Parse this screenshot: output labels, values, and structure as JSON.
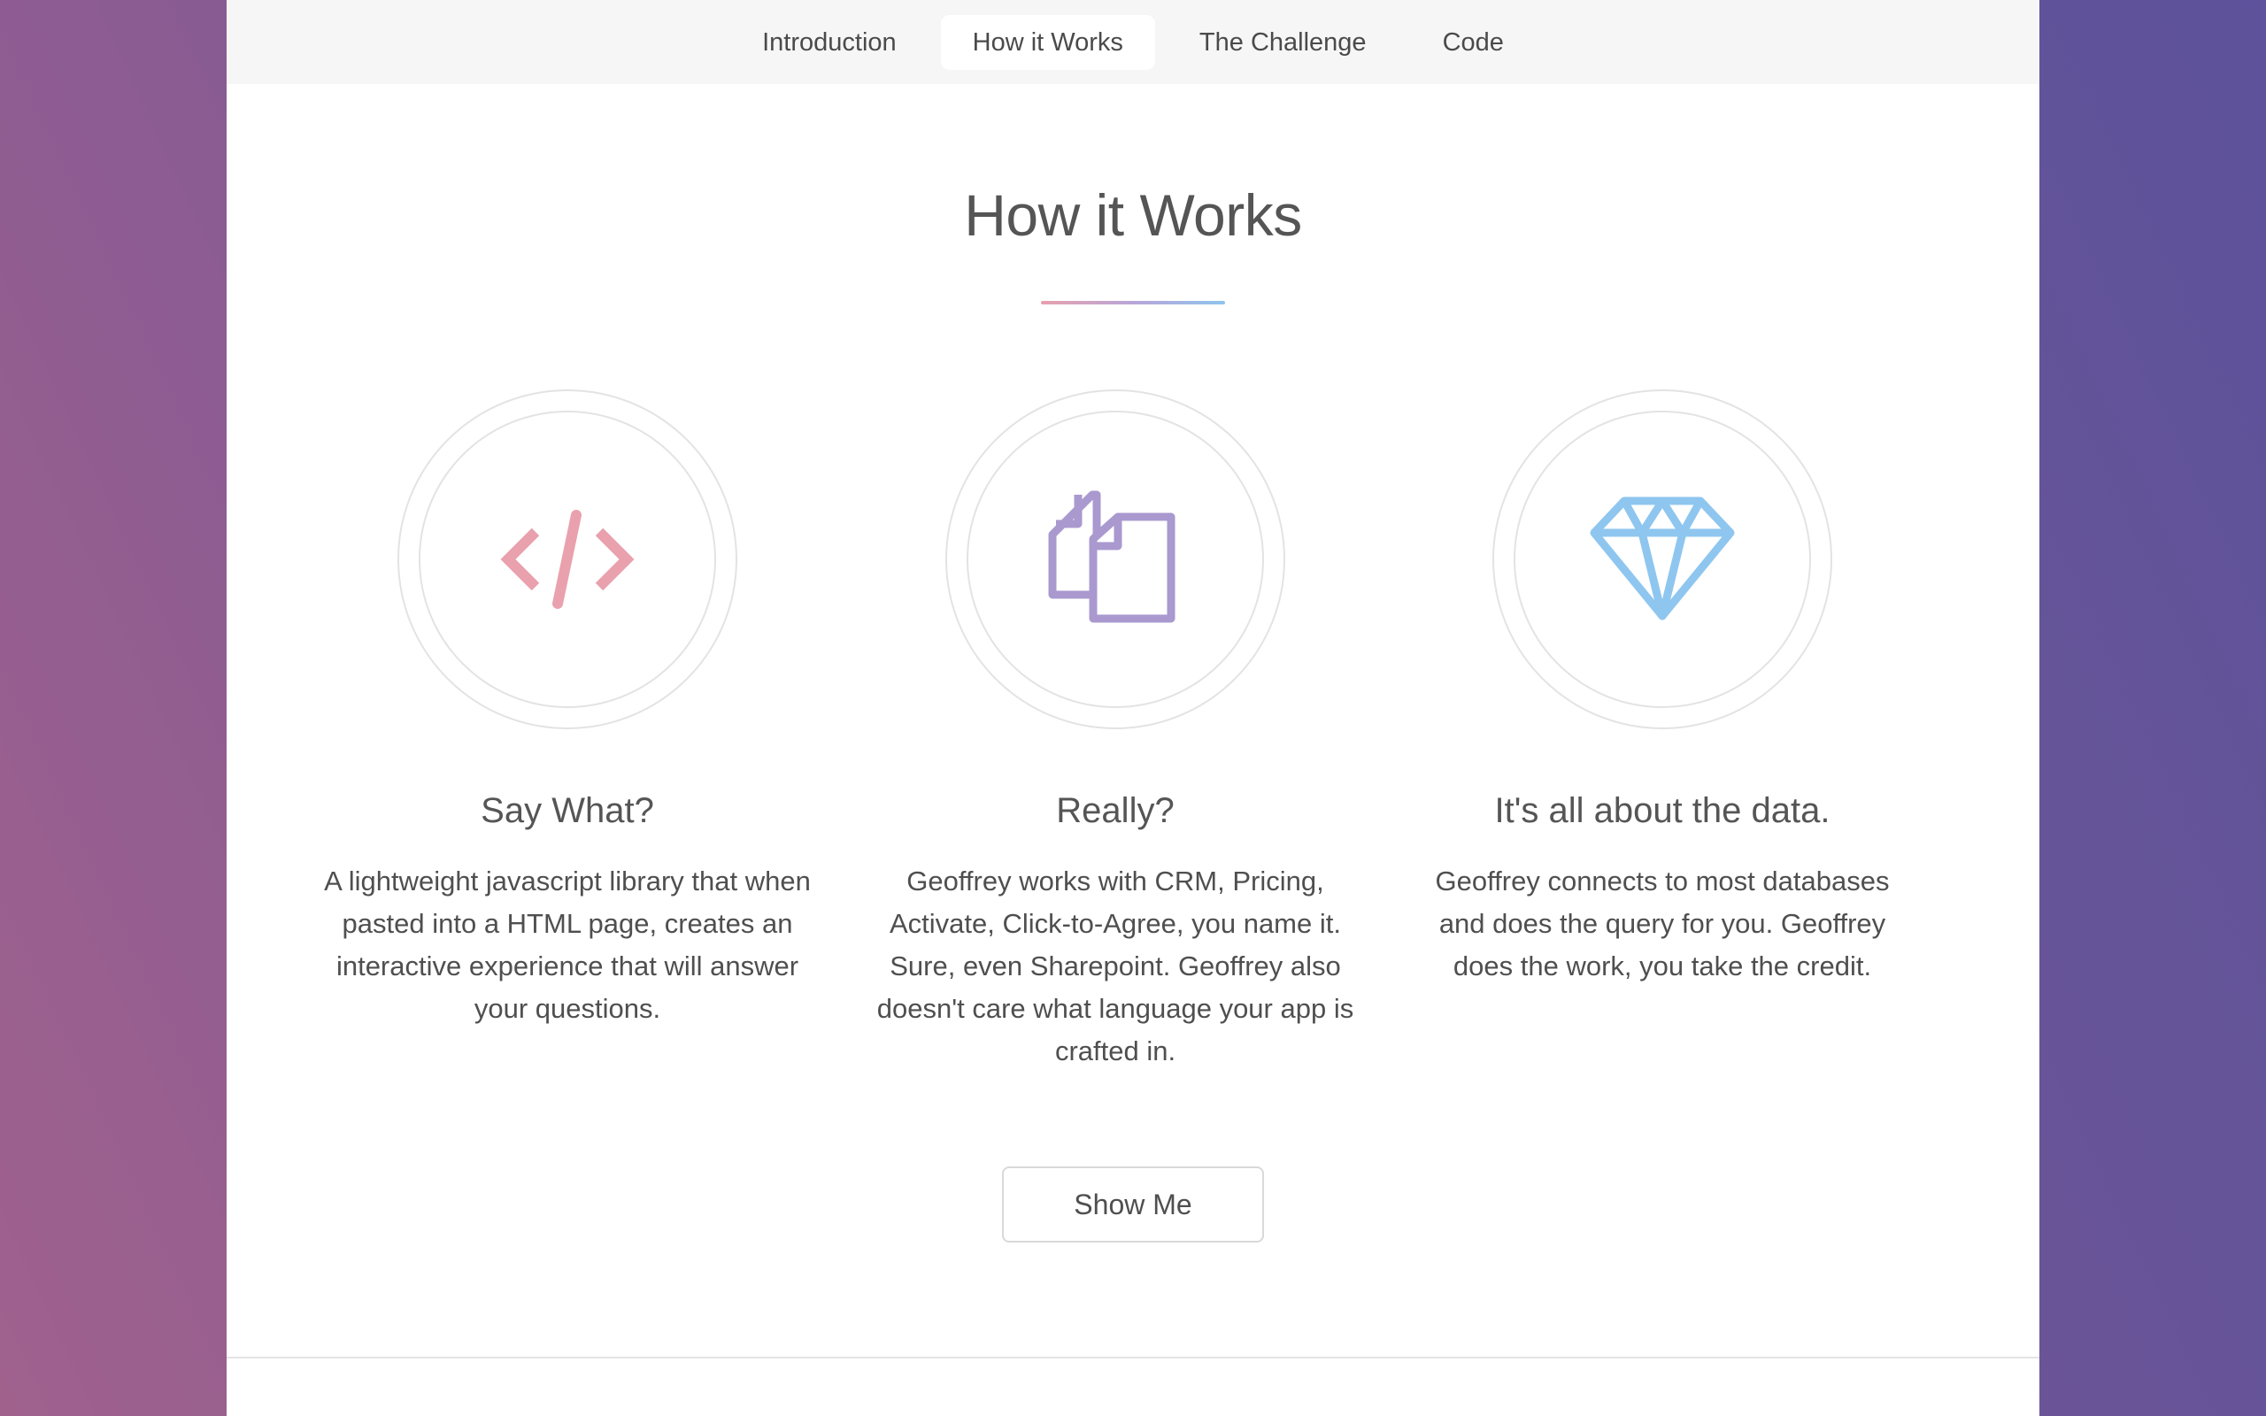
{
  "nav": {
    "items": [
      {
        "label": "Introduction",
        "active": false
      },
      {
        "label": "How it Works",
        "active": true
      },
      {
        "label": "The Challenge",
        "active": false
      },
      {
        "label": "Code",
        "active": false
      }
    ]
  },
  "section": {
    "title": "How it Works"
  },
  "features": [
    {
      "icon": "code-icon",
      "heading": "Say What?",
      "text": "A lightweight javascript library that when pasted into a HTML page, creates an interactive experience that will answer your questions."
    },
    {
      "icon": "documents-icon",
      "heading": "Really?",
      "text": "Geoffrey works with CRM, Pricing, Activate, Click-to-Agree, you name it. Sure, even Sharepoint. Geoffrey also doesn't care what language your app is crafted in."
    },
    {
      "icon": "diamond-icon",
      "heading": "It's all about the data.",
      "text": "Geoffrey connects to most databases and does the query for you. Geoffrey does the work, you take the credit."
    }
  ],
  "cta": {
    "label": "Show Me"
  },
  "colors": {
    "code_icon": "#e9a1ad",
    "documents_icon": "#a999cf",
    "diamond_icon": "#8ec6ef",
    "background_start": "#a0618d",
    "background_end": "#5d529b"
  }
}
